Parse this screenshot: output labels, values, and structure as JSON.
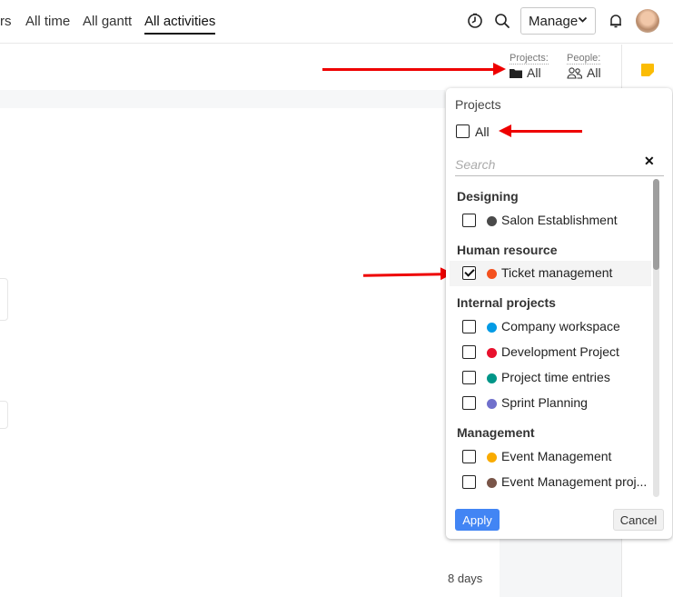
{
  "nav": {
    "tabs": [
      {
        "label": "rs",
        "active": false
      },
      {
        "label": "All time",
        "active": false
      },
      {
        "label": "All gantt",
        "active": false
      },
      {
        "label": "All activities",
        "active": true
      }
    ],
    "manage_label": "Manage",
    "icons": [
      "timer-icon",
      "search-icon",
      "bell-icon"
    ]
  },
  "filters": {
    "projects_label": "Projects:",
    "projects_value": "All",
    "people_label": "People:",
    "people_value": "All"
  },
  "content": {
    "duration_text": "8 days"
  },
  "dropdown": {
    "title": "Projects",
    "all_label": "All",
    "all_checked": false,
    "search_placeholder": "Search",
    "search_value": "",
    "groups": [
      {
        "name": "Designing",
        "items": [
          {
            "label": "Salon Establishment",
            "color": "#4a4a4a",
            "checked": false
          }
        ]
      },
      {
        "name": "Human resource",
        "items": [
          {
            "label": "Ticket management",
            "color": "#f4511e",
            "checked": true
          }
        ]
      },
      {
        "name": "Internal projects",
        "items": [
          {
            "label": "Company workspace",
            "color": "#039be5",
            "checked": false
          },
          {
            "label": "Development Project",
            "color": "#e8112d",
            "checked": false
          },
          {
            "label": "Project time entries",
            "color": "#009688",
            "checked": false
          },
          {
            "label": "Sprint Planning",
            "color": "#7070cc",
            "checked": false
          }
        ]
      },
      {
        "name": "Management",
        "items": [
          {
            "label": "Event Management",
            "color": "#f9ab00",
            "checked": false
          },
          {
            "label": "Event Management proj...",
            "color": "#795548",
            "checked": false
          }
        ]
      }
    ],
    "apply_label": "Apply",
    "cancel_label": "Cancel"
  },
  "colors": {
    "accent": "#4285f4",
    "annotation_arrow": "#ee0000",
    "note": "#fbbc04"
  }
}
